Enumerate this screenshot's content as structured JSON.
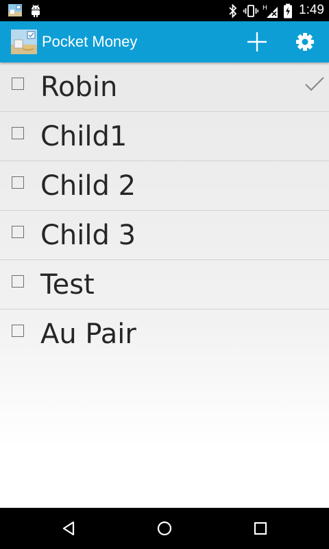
{
  "status_bar": {
    "time": "1:49",
    "icons": [
      "app-notification-icon",
      "android-debug-icon",
      "bluetooth-icon",
      "vibrate-icon",
      "no-signal-icon",
      "battery-charging-icon"
    ]
  },
  "action_bar": {
    "title": "Pocket Money",
    "background_color": "#0e9ed6",
    "add_button_icon": "plus-icon",
    "settings_button_icon": "gear-icon"
  },
  "children": [
    {
      "name": "Robin",
      "checked": false,
      "selected": true
    },
    {
      "name": "Child1",
      "checked": false,
      "selected": false
    },
    {
      "name": "Child 2",
      "checked": false,
      "selected": false
    },
    {
      "name": "Child 3",
      "checked": false,
      "selected": false
    },
    {
      "name": "Test",
      "checked": false,
      "selected": false
    },
    {
      "name": "Au Pair",
      "checked": false,
      "selected": false
    }
  ],
  "nav_bar": {
    "buttons": [
      "back-icon",
      "home-icon",
      "recents-icon"
    ]
  }
}
